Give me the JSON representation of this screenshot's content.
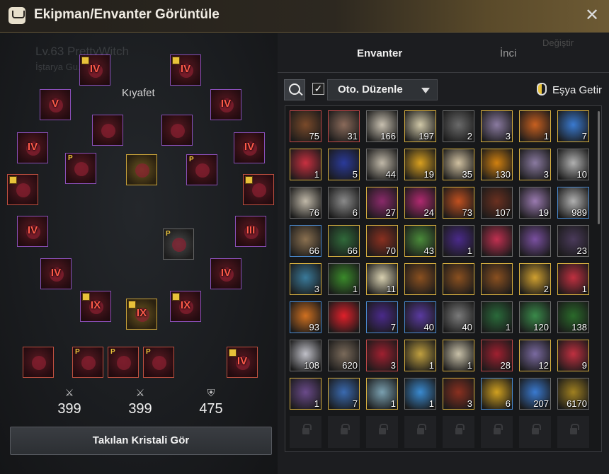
{
  "window": {
    "title": "Ekipman/Envanter Görüntüle",
    "icon": "bag-icon",
    "close_icon": "close-icon"
  },
  "character": {
    "name_ghost": "Lv.63  PrettyWitch",
    "guild_ghost": "İştarya Gu..."
  },
  "equipment": {
    "section_label": "Kıyafet",
    "slots": [
      {
        "enh": "IV",
        "key": true,
        "border": "purple"
      },
      {
        "enh": "IV",
        "key": true,
        "border": "purple"
      },
      {
        "enh": "V",
        "key": false,
        "border": "purple"
      },
      {
        "enh": "IV",
        "key": false,
        "border": "purple"
      },
      {
        "enh": "",
        "key": false,
        "border": "purple"
      },
      {
        "enh": "",
        "key": false,
        "border": "purple"
      },
      {
        "enh": "IV",
        "key": false,
        "border": "purple"
      },
      {
        "enh": "IV",
        "key": false,
        "border": "purple"
      },
      {
        "enh": "",
        "p": true,
        "border": "purple"
      },
      {
        "enh": "",
        "border": "gold"
      },
      {
        "enh": "",
        "p": true,
        "border": "purple"
      },
      {
        "enh": "",
        "key": true,
        "border": "red"
      },
      {
        "enh": "",
        "key": true,
        "border": "red"
      },
      {
        "enh": "IV",
        "border": "purple"
      },
      {
        "enh": "III",
        "border": "purple"
      },
      {
        "enh": "",
        "p": true,
        "border": "plain"
      },
      {
        "enh": "IV",
        "border": "purple"
      },
      {
        "enh": "IV",
        "border": "purple"
      },
      {
        "enh": "IX",
        "key": true,
        "border": "purple"
      },
      {
        "enh": "IX",
        "key": true,
        "border": "gold"
      },
      {
        "enh": "IX",
        "key": true,
        "border": "purple"
      },
      {
        "enh": "",
        "border": "red"
      },
      {
        "enh": "",
        "p": true,
        "border": "red"
      },
      {
        "enh": "",
        "p": true,
        "border": "red"
      },
      {
        "enh": "",
        "p": true,
        "border": "red"
      },
      {
        "enh": "IV",
        "key": true,
        "border": "red"
      }
    ],
    "stats": [
      {
        "icon": "attack-icon",
        "value": "399"
      },
      {
        "icon": "awakening-attack-icon",
        "value": "399"
      },
      {
        "icon": "defense-icon",
        "value": "475"
      }
    ],
    "crystal_button": "Takılan Kristali Gör"
  },
  "inventory": {
    "tabs": [
      {
        "label": "Envanter"
      },
      {
        "label": "İnci"
      },
      {
        "label": "Değiştir"
      }
    ],
    "search_icon": "search-icon",
    "auto_sort_checked": true,
    "sort_label": "Oto. Düzenle",
    "bring_label": "Eşya Getir",
    "items": [
      {
        "c": "75",
        "b": "red",
        "bg": "#7a4a2a"
      },
      {
        "c": "31",
        "b": "red",
        "bg": "#8a6a5a"
      },
      {
        "c": "166",
        "b": "plain",
        "bg": "#c8c0b0"
      },
      {
        "c": "197",
        "b": "gold",
        "bg": "#d0c8a8"
      },
      {
        "c": "2",
        "b": "plain",
        "bg": "#6a6a6a"
      },
      {
        "c": "3",
        "b": "gold",
        "bg": "#8a7aa0"
      },
      {
        "c": "1",
        "b": "gold",
        "bg": "#c86020"
      },
      {
        "c": "7",
        "b": "gold",
        "bg": "#3a7ad0"
      },
      {
        "c": "1",
        "b": "gold",
        "bg": "#c83040"
      },
      {
        "c": "5",
        "b": "gold",
        "bg": "#2a3a9a"
      },
      {
        "c": "44",
        "b": "plain",
        "bg": "#c0b8a8"
      },
      {
        "c": "19",
        "b": "gold",
        "bg": "#d8a020"
      },
      {
        "c": "35",
        "b": "gold",
        "bg": "#d0c0a0"
      },
      {
        "c": "130",
        "b": "gold",
        "bg": "#d08010"
      },
      {
        "c": "3",
        "b": "gold",
        "bg": "#8a7aa0"
      },
      {
        "c": "10",
        "b": "plain",
        "bg": "#b0b0b0"
      },
      {
        "c": "76",
        "b": "plain",
        "bg": "#c0b8a8"
      },
      {
        "c": "6",
        "b": "plain",
        "bg": "#8a8a8a"
      },
      {
        "c": "27",
        "b": "gold",
        "bg": "#8a2a6a"
      },
      {
        "c": "24",
        "b": "gold",
        "bg": "#b02a70"
      },
      {
        "c": "73",
        "b": "gold",
        "bg": "#c05020"
      },
      {
        "c": "107",
        "b": "plain",
        "bg": "#6a3020"
      },
      {
        "c": "19",
        "b": "plain",
        "bg": "#9a7ab0"
      },
      {
        "c": "989",
        "b": "blue",
        "bg": "#b0b0b0"
      },
      {
        "c": "66",
        "b": "blue",
        "bg": "#8a7050"
      },
      {
        "c": "66",
        "b": "gold",
        "bg": "#306a3a"
      },
      {
        "c": "70",
        "b": "gold",
        "bg": "#8a3020"
      },
      {
        "c": "43",
        "b": "gold",
        "bg": "#4a8a3a"
      },
      {
        "c": "1",
        "b": "plain",
        "bg": "#4a2a8a"
      },
      {
        "c": "",
        "b": "plain",
        "bg": "#c03050"
      },
      {
        "c": "",
        "b": "plain",
        "bg": "#7a50a0"
      },
      {
        "c": "23",
        "b": "plain",
        "bg": "#4a3a5a"
      },
      {
        "c": "3",
        "b": "gold",
        "bg": "#3a7a9a"
      },
      {
        "c": "1",
        "b": "plain",
        "bg": "#3a8a2a"
      },
      {
        "c": "11",
        "b": "gold",
        "bg": "#d8d0b0"
      },
      {
        "c": "",
        "b": "gold",
        "bg": "#8a5020"
      },
      {
        "c": "",
        "b": "gold",
        "bg": "#8a5020"
      },
      {
        "c": "",
        "b": "gold",
        "bg": "#8a5020"
      },
      {
        "c": "2",
        "b": "gold",
        "bg": "#d0a030"
      },
      {
        "c": "1",
        "b": "gold",
        "bg": "#c03040"
      },
      {
        "c": "93",
        "b": "blue",
        "bg": "#d07020"
      },
      {
        "c": "",
        "b": "plain",
        "bg": "#e0202a"
      },
      {
        "c": "7",
        "b": "blue",
        "bg": "#4a2a8a"
      },
      {
        "c": "40",
        "b": "blue",
        "bg": "#5a3aa0"
      },
      {
        "c": "40",
        "b": "plain",
        "bg": "#7a7a7a"
      },
      {
        "c": "1",
        "b": "plain",
        "bg": "#2a6a3a"
      },
      {
        "c": "120",
        "b": "plain",
        "bg": "#3a8a4a"
      },
      {
        "c": "138",
        "b": "plain",
        "bg": "#2a6a2a"
      },
      {
        "c": "108",
        "b": "plain",
        "bg": "#c0c0c8"
      },
      {
        "c": "620",
        "b": "plain",
        "bg": "#7a6a5a"
      },
      {
        "c": "3",
        "b": "red",
        "bg": "#a02030"
      },
      {
        "c": "1",
        "b": "gold",
        "bg": "#c0a040"
      },
      {
        "c": "1",
        "b": "gold",
        "bg": "#c8c0a8"
      },
      {
        "c": "28",
        "b": "red",
        "bg": "#a02030"
      },
      {
        "c": "12",
        "b": "gold",
        "bg": "#7a6aa0"
      },
      {
        "c": "9",
        "b": "gold",
        "bg": "#c03040"
      },
      {
        "c": "1",
        "b": "gold",
        "bg": "#6a4a8a"
      },
      {
        "c": "7",
        "b": "gold",
        "bg": "#3a6ab0"
      },
      {
        "c": "1",
        "b": "gold",
        "bg": "#7aa0b0"
      },
      {
        "c": "1",
        "b": "plain",
        "bg": "#3a8ad0"
      },
      {
        "c": "3",
        "b": "gold",
        "bg": "#8a3020"
      },
      {
        "c": "6",
        "b": "blue",
        "bg": "#d0a020"
      },
      {
        "c": "207",
        "b": "plain",
        "bg": "#3a7ad0"
      },
      {
        "c": "6170",
        "b": "plain",
        "bg": "#a08020"
      }
    ],
    "locked_slots": 8
  }
}
